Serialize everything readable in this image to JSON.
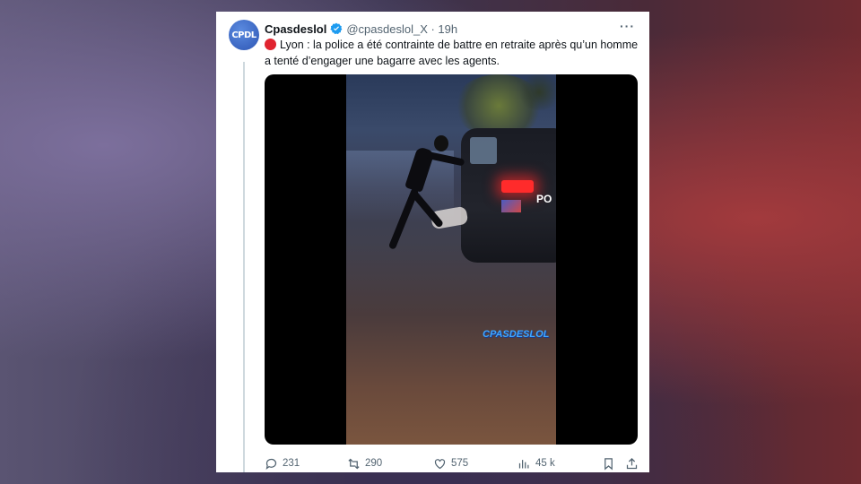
{
  "tweet": {
    "avatar_text": "CPDL",
    "author_name": "Cpasdeslol",
    "handle_time": "@cpasdeslol_X · 19h",
    "more_label": "···",
    "text": "Lyon : la police a été contrainte de battre en retraite après qu’un homme a tenté d’engager une bagarre avec les agents.",
    "video_watermark": "CPASDESLOL",
    "car_text": "PO",
    "verified_color": "#1d9bf0",
    "stats": {
      "replies": "231",
      "reposts": "290",
      "likes": "575",
      "views": "45 k"
    }
  }
}
